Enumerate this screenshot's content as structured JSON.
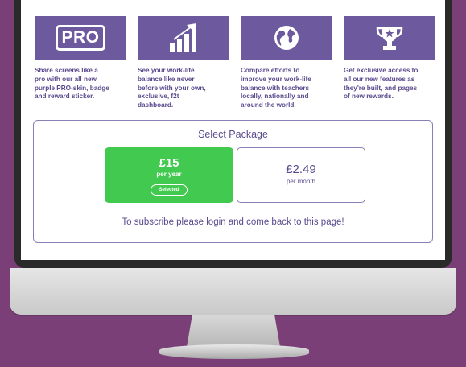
{
  "features": [
    {
      "icon": "pro-badge-icon",
      "icon_text": "PRO",
      "text": "Share screens like a\npro with our all new\npurple PRO-skin, badge\nand reward sticker."
    },
    {
      "icon": "bar-chart-icon",
      "text": "See your work-life\nbalance like never\nbefore with your own,\nexclusive, f2t\ndashboard."
    },
    {
      "icon": "globe-icon",
      "text": "Compare efforts to\nimprove your work-life\nbalance with teachers\nlocally, nationally and\naround the world."
    },
    {
      "icon": "trophy-icon",
      "text": "Get exclusive access to\nall our new features as\nthey're built, and pages\nof new rewards."
    }
  ],
  "package": {
    "title": "Select Package",
    "options": [
      {
        "price": "£15",
        "period": "per year",
        "status": "Selected"
      },
      {
        "price": "£2.49",
        "period": "per month"
      }
    ],
    "note": "To subscribe please login and come back to this page!"
  },
  "colors": {
    "background": "#7b3f78",
    "tile": "#6d5a9e",
    "text": "#5a4a8e",
    "selected": "#42c94f"
  }
}
